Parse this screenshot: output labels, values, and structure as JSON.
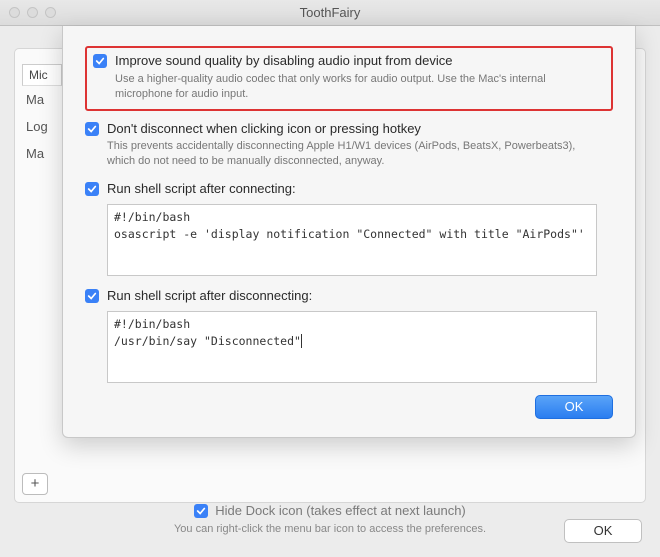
{
  "window": {
    "title": "ToothFairy"
  },
  "sidebar": {
    "header": "Mic",
    "items": [
      "Ma",
      "Log",
      "Ma"
    ]
  },
  "addButton": "+",
  "options": {
    "improve": {
      "label": "Improve sound quality by disabling audio input from device",
      "desc": "Use a higher-quality audio codec that only works for audio output. Use the Mac's internal microphone for audio input."
    },
    "dontDisconnect": {
      "label": "Don't disconnect when clicking icon or pressing hotkey",
      "desc": "This prevents accidentally disconnecting Apple H1/W1 devices (AirPods, BeatsX, Powerbeats3), which do not need to be manually disconnected, anyway."
    },
    "connectScript": {
      "label": "Run shell script after connecting:",
      "script": "#!/bin/bash\nosascript -e 'display notification \"Connected\" with title \"AirPods\"'"
    },
    "disconnectScript": {
      "label": "Run shell script after disconnecting:",
      "script": "#!/bin/bash\n/usr/bin/say \"Disconnected\""
    }
  },
  "sheetOk": "OK",
  "dock": {
    "label": "Hide Dock icon (takes effect at next launch)",
    "desc": "You can right-click the menu bar icon to access the preferences."
  },
  "outerOk": "OK"
}
